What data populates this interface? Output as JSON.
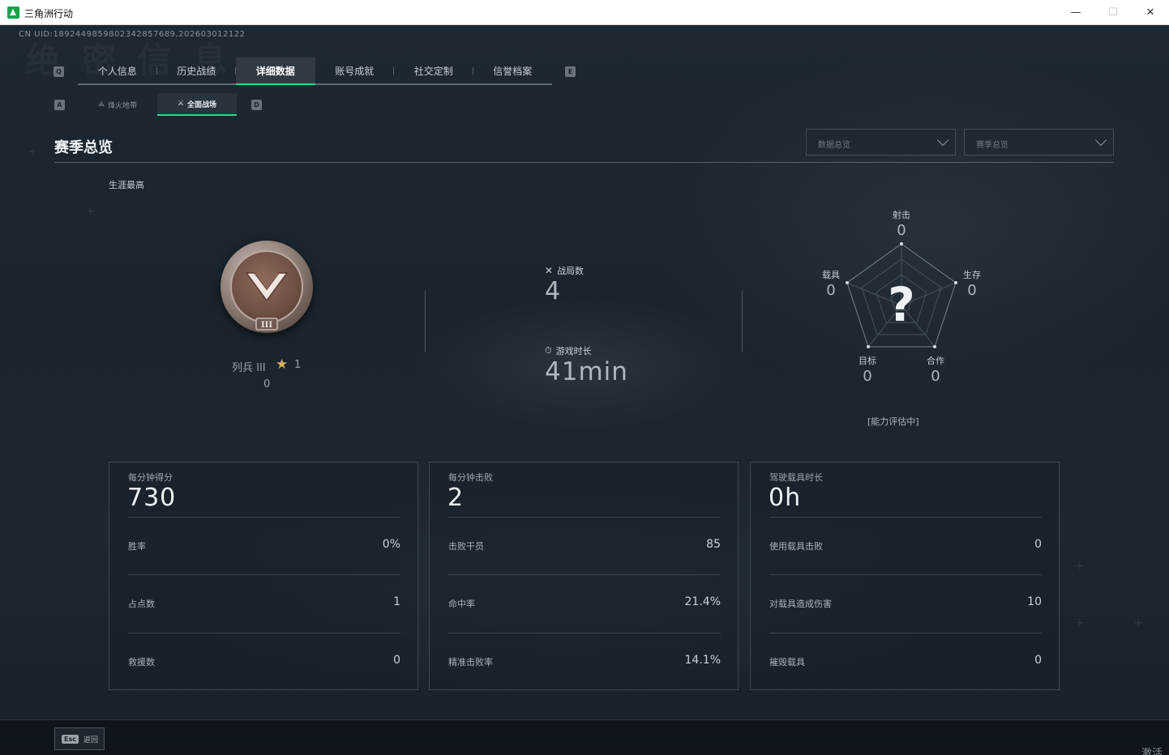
{
  "window": {
    "title": "三角洲行动",
    "minimize": "—",
    "maximize": "☐",
    "close": "✕"
  },
  "uid": "CN UID:18924498598023428576​89,202603012122",
  "nav": {
    "left_key": "Q",
    "right_key": "E",
    "tabs": [
      "个人信息",
      "历史战绩",
      "详细数据",
      "账号成就",
      "社交定制",
      "信誉档案"
    ],
    "active_index": 2
  },
  "subnav": {
    "left_key": "A",
    "right_key": "D",
    "tabs": [
      "烽火地带",
      "全面战场"
    ],
    "active_index": 1
  },
  "section": {
    "title": "赛季总览",
    "dropdown_1": "数据总览",
    "dropdown_2": "赛季总览",
    "career_label": "生涯最高"
  },
  "rank": {
    "name": "列兵 III",
    "stars": "1",
    "score": "0",
    "tier_numeral": "III"
  },
  "center_stats": {
    "matches_label": "战局数",
    "matches_value": "4",
    "playtime_label": "游戏时长",
    "playtime_value": "41min"
  },
  "radar": {
    "axes": [
      {
        "label": "射击",
        "value": "0"
      },
      {
        "label": "生存",
        "value": "0"
      },
      {
        "label": "合作",
        "value": "0"
      },
      {
        "label": "目标",
        "value": "0"
      },
      {
        "label": "载具",
        "value": "0"
      }
    ],
    "center_glyph": "?",
    "status": "[能力评估中]"
  },
  "cards": [
    {
      "label": "每分钟得分",
      "main": "730",
      "rows": [
        {
          "label": "胜率",
          "value": "0%"
        },
        {
          "label": "占点数",
          "value": "1"
        },
        {
          "label": "救援数",
          "value": "0"
        }
      ]
    },
    {
      "label": "每分钟击败",
      "main": "2",
      "rows": [
        {
          "label": "击败干员",
          "value": "85"
        },
        {
          "label": "命中率",
          "value": "21.4%"
        },
        {
          "label": "精准击败率",
          "value": "14.1%"
        }
      ]
    },
    {
      "label": "驾驶载具时长",
      "main": "0h",
      "rows": [
        {
          "label": "使用载具击败",
          "value": "0"
        },
        {
          "label": "对载具造成伤害",
          "value": "10"
        },
        {
          "label": "摧毁载具",
          "value": "0"
        }
      ]
    }
  ],
  "bottom": {
    "esc_key": "Esc",
    "back_label": "返回",
    "corner_text": "激活"
  },
  "colors": {
    "accent": "#2ed68c",
    "star": "#d7b35a",
    "background": "#1b242d"
  }
}
